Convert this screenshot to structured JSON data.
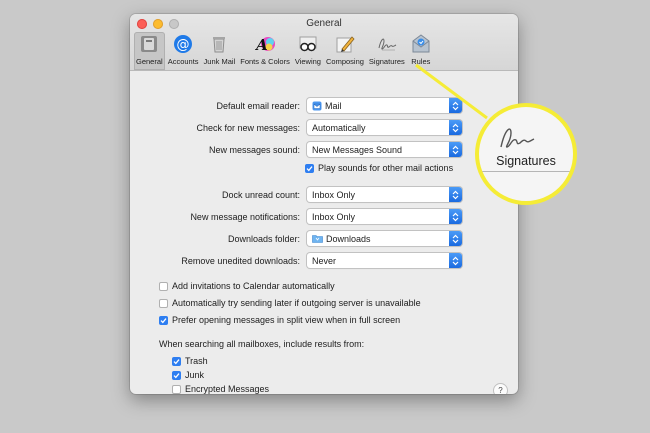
{
  "window": {
    "title": "General"
  },
  "toolbar": {
    "items": [
      {
        "label": "General",
        "icon": "general-icon",
        "selected": true
      },
      {
        "label": "Accounts",
        "icon": "at-sign-icon"
      },
      {
        "label": "Junk Mail",
        "icon": "trash-junk-icon"
      },
      {
        "label": "Fonts & Colors",
        "icon": "fonts-colors-icon"
      },
      {
        "label": "Viewing",
        "icon": "glasses-icon"
      },
      {
        "label": "Composing",
        "icon": "pencil-paper-icon"
      },
      {
        "label": "Signatures",
        "icon": "signature-icon"
      },
      {
        "label": "Rules",
        "icon": "rules-envelope-icon"
      }
    ]
  },
  "settings": {
    "default_reader": {
      "label": "Default email reader:",
      "value": "Mail"
    },
    "check_messages": {
      "label": "Check for new messages:",
      "value": "Automatically"
    },
    "new_sound": {
      "label": "New messages sound:",
      "value": "New Messages Sound"
    },
    "play_sounds": {
      "label": "Play sounds for other mail actions",
      "checked": true
    },
    "dock_count": {
      "label": "Dock unread count:",
      "value": "Inbox Only"
    },
    "notifications": {
      "label": "New message notifications:",
      "value": "Inbox Only"
    },
    "downloads_folder": {
      "label": "Downloads folder:",
      "value": "Downloads"
    },
    "remove_downloads": {
      "label": "Remove unedited downloads:",
      "value": "Never"
    },
    "add_invitations": {
      "label": "Add invitations to Calendar automatically",
      "checked": false
    },
    "try_sending": {
      "label": "Automatically try sending later if outgoing server is unavailable",
      "checked": false
    },
    "prefer_split": {
      "label": "Prefer opening messages in split view when in full screen",
      "checked": true
    },
    "search_heading": "When searching all mailboxes, include results from:",
    "search_trash": {
      "label": "Trash",
      "checked": true
    },
    "search_junk": {
      "label": "Junk",
      "checked": true
    },
    "search_encrypted": {
      "label": "Encrypted Messages",
      "checked": false
    },
    "help": "?"
  },
  "callout": {
    "label": "Signatures",
    "color": "#f5ec36"
  }
}
